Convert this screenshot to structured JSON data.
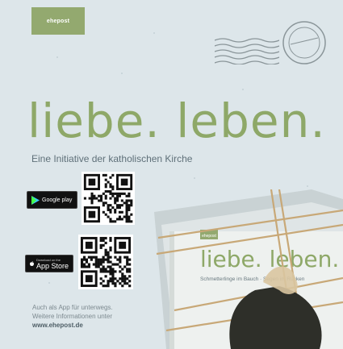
{
  "brand": {
    "logo_text": "ehepost"
  },
  "headline": {
    "title": "liebe. leben.",
    "subtitle": "Eine Initiative der katholischen Kirche"
  },
  "stores": {
    "google": {
      "icon": "play-store-icon",
      "label": "Google play"
    },
    "apple": {
      "icon": "apple-icon",
      "small": "Download on the",
      "label": "App Store"
    }
  },
  "info": {
    "line1": "Auch als App für unterwegs.",
    "line2": "Weitere Informationen unter",
    "url": "www.ehepost.de"
  },
  "book": {
    "title": "liebe. leben.",
    "subtitle": "Schmetterlinge im Bauch · Segen im Rücken",
    "logo": "ehepost"
  },
  "colors": {
    "background": "#dde6ea",
    "accent_green": "#8ea868",
    "brand_green": "#93a96f",
    "text_grey": "#5f7079"
  }
}
